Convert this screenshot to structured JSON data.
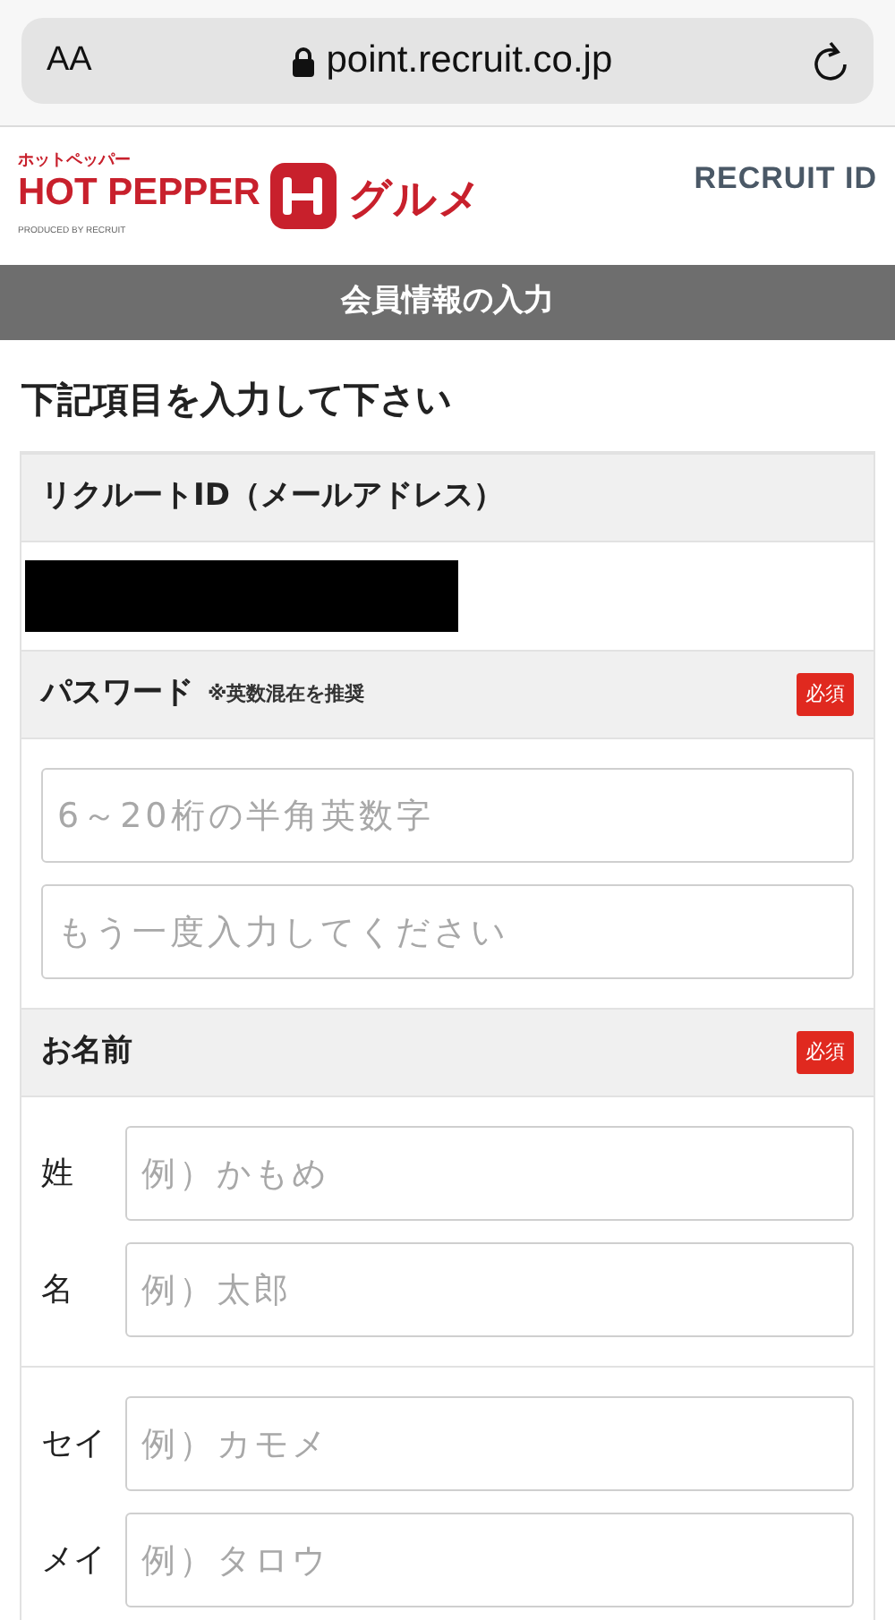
{
  "browser": {
    "text_size": "AA",
    "url": "point.recruit.co.jp"
  },
  "header": {
    "logo_kana": "ホットペッパー",
    "logo_name": "HOT PEPPER",
    "logo_suffix": "グルメ",
    "logo_credit": "PRODUCED BY RECRUIT",
    "partner_logo": "RECRUIT ID"
  },
  "page_title": "会員情報の入力",
  "instruction": "下記項目を入力して下さい",
  "sections": [
    {
      "label": "リクルートID（メールアドレス）",
      "kind": "redacted"
    },
    {
      "label": "パスワード",
      "note": "※英数混在を推奨",
      "badge": "必須",
      "kind": "fields",
      "fields": [
        {
          "placeholder": "6～20桁の半角英数字"
        },
        {
          "placeholder": "もう一度入力してください"
        }
      ]
    },
    {
      "label": "お名前",
      "badge": "必須",
      "kind": "labeled",
      "groups": [
        [
          {
            "label": "姓",
            "placeholder": "例）かもめ"
          },
          {
            "label": "名",
            "placeholder": "例）太郎"
          }
        ],
        [
          {
            "label": "セイ",
            "placeholder": "例）カモメ"
          },
          {
            "label": "メイ",
            "placeholder": "例）タロウ"
          }
        ]
      ]
    }
  ]
}
